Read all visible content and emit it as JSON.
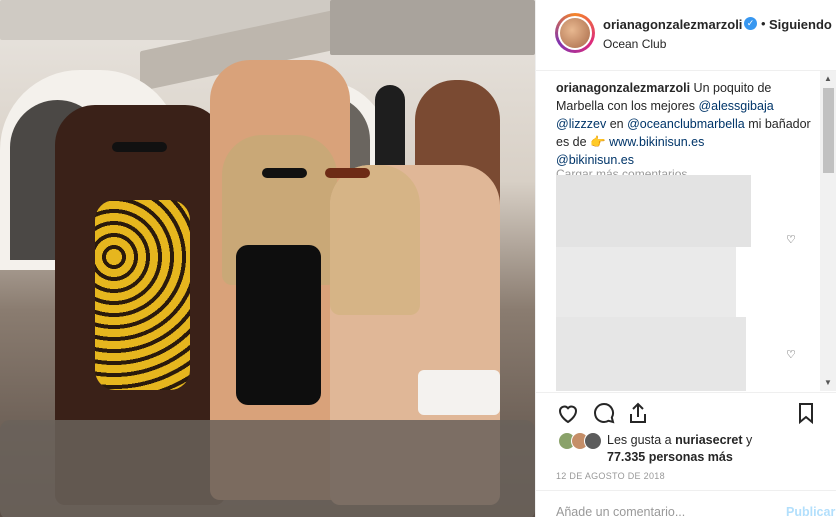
{
  "post": {
    "username": "orianagonzalezmarzoli",
    "verified_mark": "✓",
    "separator": "•",
    "follow_label": "Siguiendo",
    "location": "Ocean Club",
    "caption_user": "orianagonzalezmarzoli",
    "caption_text_1": "Un poquito de Marbella con los mejores",
    "mention_1": "@alessgibaja",
    "mention_2": "@lizzzev",
    "caption_text_2": "en",
    "mention_3": "@oceanclubmarbella",
    "caption_text_3": "mi bañador es de",
    "pointing_emoji": "👉",
    "site": "www.bikinisun.es",
    "mention_4": "@bikinisun.es",
    "load_more": "Cargar más comentarios",
    "likes_prefix": "Les gusta a",
    "likes_user": "nuriasecret",
    "likes_suffix": "y",
    "likes_count": "77.335 personas más",
    "date": "12 DE AGOSTO DE 2018",
    "comment_placeholder": "Añade un comentario...",
    "publish_label": "Publicar"
  },
  "icons": {
    "heart": "heart-icon",
    "comment": "comment-icon",
    "share": "share-icon",
    "save": "bookmark-icon"
  },
  "colors": {
    "link": "#003569",
    "verified": "#3897f0"
  }
}
